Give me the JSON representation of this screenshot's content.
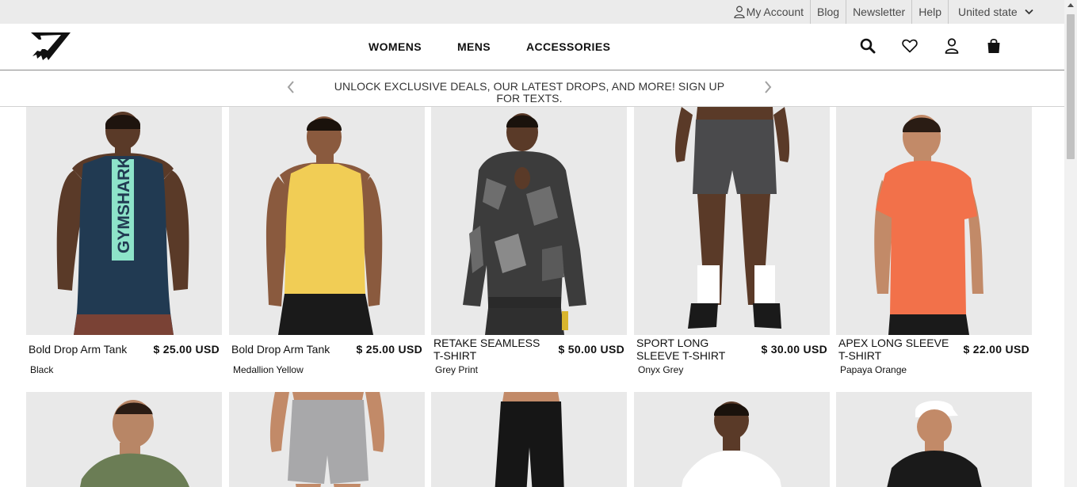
{
  "utility": {
    "my_account": "My Account",
    "blog": "Blog",
    "newsletter": "Newsletter",
    "help": "Help",
    "country": "United state"
  },
  "header": {
    "logo": "gymshark-logo",
    "nav": [
      "WOMENS",
      "MENS",
      "ACCESSORIES"
    ],
    "icons": [
      "search-icon",
      "heart-icon",
      "user-icon",
      "bag-icon"
    ]
  },
  "promo": {
    "text": "UNLOCK EXCLUSIVE DEALS, OUR LATEST DROPS, AND MORE! SIGN UP FOR TEXTS."
  },
  "products": [
    {
      "name": "Bold Drop Arm Tank",
      "price": "$ 25.00 USD",
      "color": "Black",
      "print": "GYMSHARK"
    },
    {
      "name": "Bold Drop Arm Tank",
      "price": "$ 25.00 USD",
      "color": "Medallion Yellow"
    },
    {
      "name": "RETAKE SEAMLESS T-SHIRT",
      "price": "$ 50.00 USD",
      "color": "Grey Print"
    },
    {
      "name": "SPORT LONG SLEEVE T-SHIRT",
      "price": "$ 30.00 USD",
      "color": "Onyx Grey"
    },
    {
      "name": "APEX LONG SLEEVE T-SHIRT",
      "price": "$ 22.00 USD",
      "color": "Papaya Orange"
    }
  ],
  "colors": {
    "utility_bg": "#ebebeb",
    "product_bg": "#e9e9e9",
    "text": "#111111"
  }
}
